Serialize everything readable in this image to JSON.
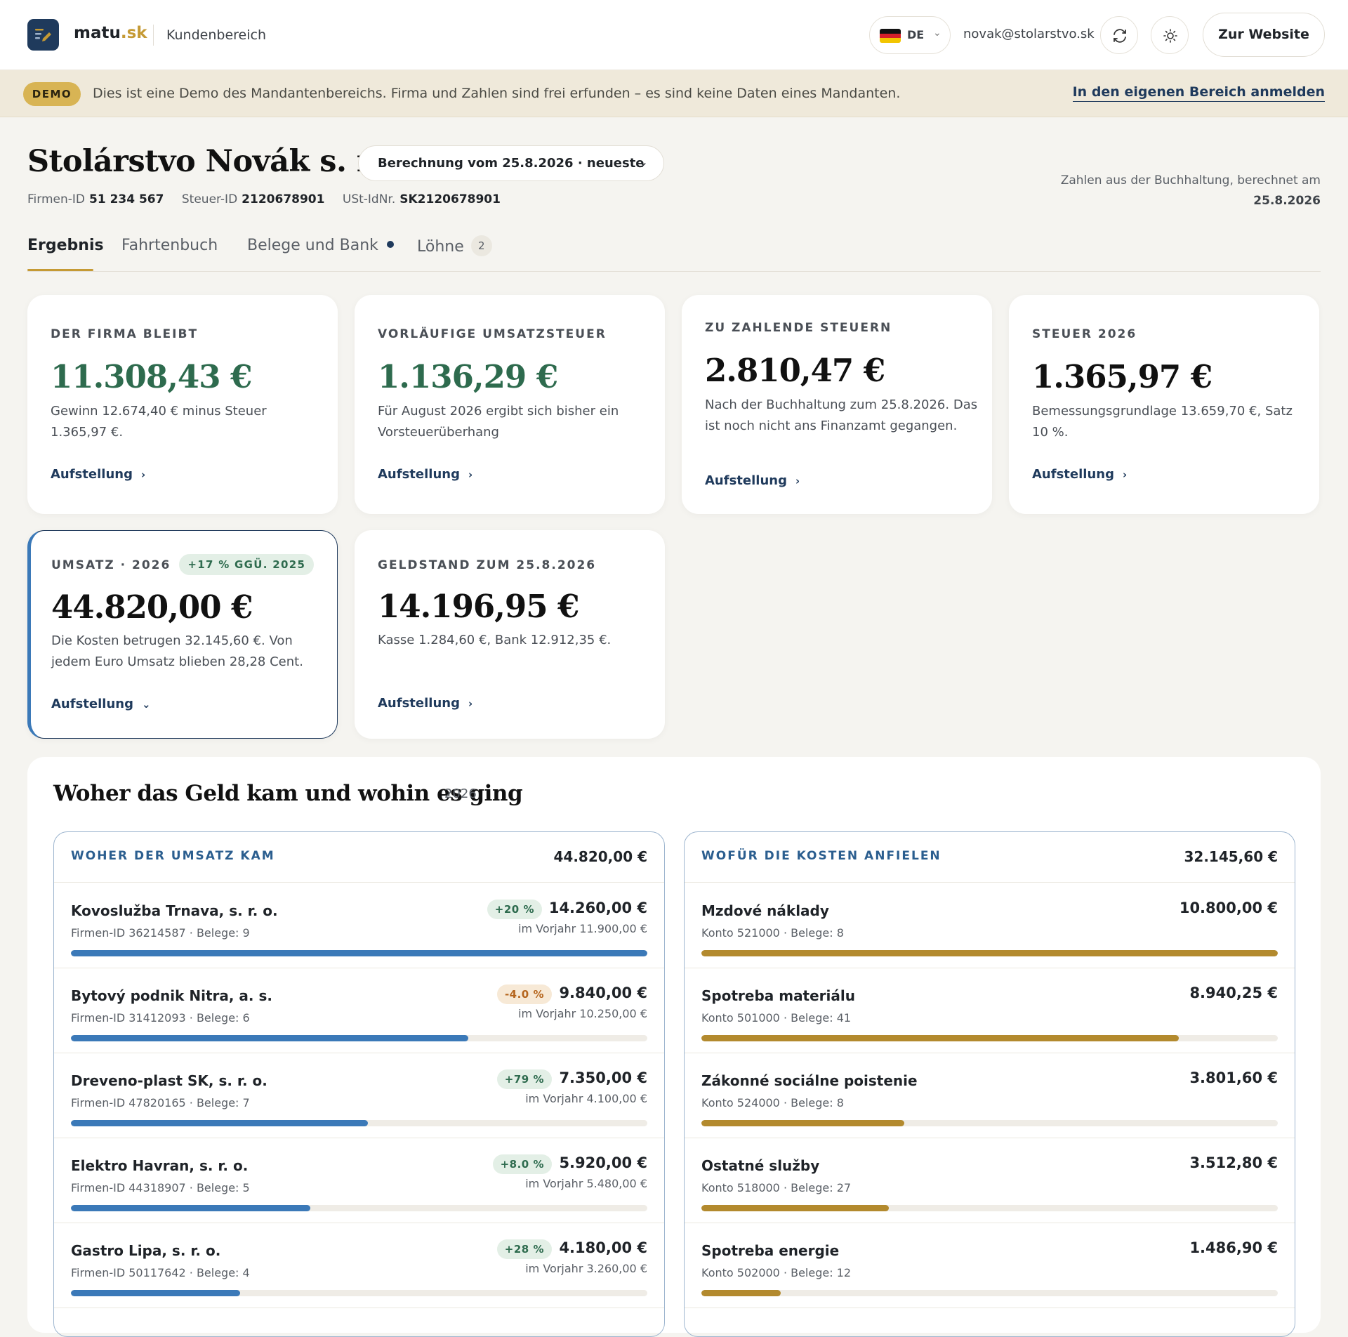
{
  "header": {
    "brand_name": "matu",
    "brand_tld": ".sk",
    "portal_label": "Kundenbereich",
    "language_code": "DE",
    "user_email": "novak@stolarstvo.sk",
    "website_button": "Zur Website"
  },
  "banner": {
    "pill": "DEMO",
    "text": "Dies ist eine Demo des Mandantenbereichs. Firma und Zahlen sind frei erfunden – es sind keine Daten eines Mandanten.",
    "link": "In den eigenen Bereich anmelden"
  },
  "company": {
    "name": "Stolárstvo Novák s. r. o.",
    "calculation_select": "Berechnung vom 25.8.2026 · neueste",
    "ids": [
      {
        "label": "Firmen-ID",
        "value": "51 234 567"
      },
      {
        "label": "Steuer-ID",
        "value": "2120678901"
      },
      {
        "label": "USt-IdNr.",
        "value": "SK2120678901"
      }
    ],
    "note_text": "Zahlen aus der Buchhaltung, berechnet am",
    "note_date": "25.8.2026"
  },
  "tabs": [
    {
      "label": "Ergebnis",
      "active": true
    },
    {
      "label": "Fahrtenbuch"
    },
    {
      "label": "Belege und Bank"
    },
    {
      "label": "Löhne",
      "count": "2"
    }
  ],
  "cards": [
    {
      "label": "DER FIRMA BLEIBT",
      "value": "11.308,43 €",
      "desc": "Gewinn 12.674,40 € minus Steuer 1.365,97 €.",
      "link": "Aufstellung"
    },
    {
      "label": "VORLÄUFIGE UMSATZSTEUER",
      "value": "1.136,29 €",
      "desc": "Für August 2026 ergibt sich bisher ein Vorsteuerüberhang",
      "link": "Aufstellung"
    },
    {
      "label": "ZU ZAHLENDE STEUERN",
      "value": "2.810,47 €",
      "desc": "Nach der Buchhaltung zum 25.8.2026. Das ist noch nicht ans Finanzamt gegangen.",
      "link": "Aufstellung"
    },
    {
      "label": "STEUER 2026",
      "value": "1.365,97 €",
      "desc": "Bemessungsgrundlage 13.659,70 €, Satz 10 %.",
      "link": "Aufstellung"
    },
    {
      "label": "UMSATZ · 2026",
      "badge": "+17 % GGÜ. 2025",
      "value": "44.820,00 €",
      "desc": "Die Kosten betrugen 32.145,60 €. Von jedem Euro Umsatz blieben 28,28 Cent.",
      "link": "Aufstellung"
    },
    {
      "label": "GELDSTAND ZUM 25.8.2026",
      "value": "14.196,95 €",
      "desc": "Kasse 1.284,60 €, Bank 12.912,35 €.",
      "link": "Aufstellung"
    }
  ],
  "money_section": {
    "title": "Woher das Geld kam und wohin es ging",
    "year": "2026",
    "revenue": {
      "heading": "WOHER DER UMSATZ KAM",
      "total": "44.820,00 €",
      "rows": [
        {
          "name": "Kovoslužba Trnava, s. r. o.",
          "meta": "Firmen-ID 36214587 · Belege: 9",
          "amount": "14.260,00 €",
          "change": "+20 %",
          "previous": "im Vorjahr 11.900,00 €",
          "share": 1.0
        },
        {
          "name": "Bytový podnik Nitra, a. s.",
          "meta": "Firmen-ID 31412093 · Belege: 6",
          "amount": "9.840,00 €",
          "change": "-4.0 %",
          "previous": "im Vorjahr 10.250,00 €",
          "share": 0.69
        },
        {
          "name": "Dreveno-plast SK, s. r. o.",
          "meta": "Firmen-ID 47820165 · Belege: 7",
          "amount": "7.350,00 €",
          "change": "+79 %",
          "previous": "im Vorjahr 4.100,00 €",
          "share": 0.515
        },
        {
          "name": "Elektro Havran, s. r. o.",
          "meta": "Firmen-ID 44318907 · Belege: 5",
          "amount": "5.920,00 €",
          "change": "+8.0 %",
          "previous": "im Vorjahr 5.480,00 €",
          "share": 0.415
        },
        {
          "name": "Gastro Lipa, s. r. o.",
          "meta": "Firmen-ID 50117642 · Belege: 4",
          "amount": "4.180,00 €",
          "change": "+28 %",
          "previous": "im Vorjahr 3.260,00 €",
          "share": 0.293
        }
      ]
    },
    "costs": {
      "heading": "WOFÜR DIE KOSTEN ANFIELEN",
      "total": "32.145,60 €",
      "rows": [
        {
          "name": "Mzdové náklady",
          "meta": "Konto 521000 · Belege: 8",
          "amount": "10.800,00 €",
          "share": 1.0
        },
        {
          "name": "Spotreba materiálu",
          "meta": "Konto 501000 · Belege: 41",
          "amount": "8.940,25 €",
          "share": 0.828
        },
        {
          "name": "Zákonné sociálne poistenie",
          "meta": "Konto 524000 · Belege: 8",
          "amount": "3.801,60 €",
          "share": 0.352
        },
        {
          "name": "Ostatné služby",
          "meta": "Konto 518000 · Belege: 27",
          "amount": "3.512,80 €",
          "share": 0.325
        },
        {
          "name": "Spotreba energie",
          "meta": "Konto 502000 · Belege: 12",
          "amount": "1.486,90 €",
          "share": 0.138
        }
      ]
    }
  },
  "colors": {
    "accent_gold": "#c59a34",
    "brand_navy": "#1f3a5c",
    "positive": "#2e6b4e",
    "negative": "#b5651d",
    "revenue_bar": "#3b79b8",
    "cost_bar": "#b38a2e"
  }
}
